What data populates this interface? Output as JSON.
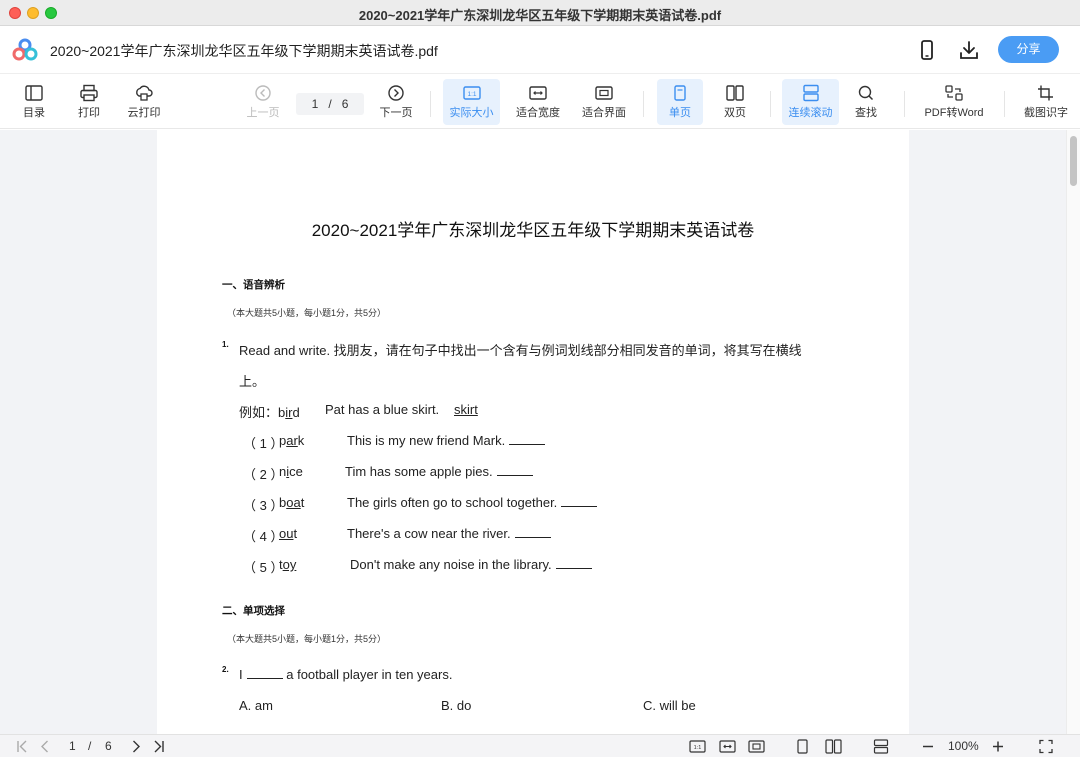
{
  "window": {
    "title": "2020~2021学年广东深圳龙华区五年级下学期期末英语试卷.pdf"
  },
  "header": {
    "doc_title": "2020~2021学年广东深圳龙华区五年级下学期期末英语试卷.pdf",
    "share_label": "分享",
    "icons": [
      "app-logo",
      "phone-icon",
      "download-icon"
    ]
  },
  "toolbar": {
    "toc": "目录",
    "print": "打印",
    "cloud_print": "云打印",
    "prev_page": "上一页",
    "page_current": "1",
    "page_sep": "/",
    "page_total": "6",
    "next_page": "下一页",
    "actual_size": "实际大小",
    "fit_width": "适合宽度",
    "fit_page": "适合界面",
    "single_page": "单页",
    "double_page": "双页",
    "continuous_scroll": "连续滚动",
    "search": "查找",
    "pdf_to_word": "PDF转Word",
    "ocr": "截图识字",
    "active_tools": [
      "实际大小",
      "单页",
      "连续滚动"
    ],
    "accent_color": "#3b8ef0"
  },
  "document": {
    "title": "2020~2021学年广东深圳龙华区五年级下学期期末英语试卷",
    "section1": {
      "title": "一、语音辨析",
      "note": "（本大题共5小题，每小题1分，共5分）"
    },
    "q1": {
      "num": "1.",
      "text_line1": "Read and write. 找朋友，请在句子中找出一个含有与例词划线部分相同发音的单词，将其写在横线",
      "text_line2": "上。",
      "example": {
        "prefix": "例如：",
        "w_a": "b",
        "w_u": "ir",
        "w_b": "d",
        "sentence": "Pat has a blue skirt.",
        "answer": "skirt"
      },
      "items": [
        {
          "label": "（ 1 ）",
          "w_a": "p",
          "w_u": "ar",
          "w_b": "k",
          "sentence": "This is my new friend Mark."
        },
        {
          "label": "（ 2 ）",
          "w_a": "n",
          "w_u": "i",
          "w_b": "ce",
          "sentence": "Tim has some apple pies."
        },
        {
          "label": "（ 3 ）",
          "w_a": "b",
          "w_u": "oa",
          "w_b": "t",
          "sentence": "The girls often go to school together."
        },
        {
          "label": "（ 4 ）",
          "w_a": "",
          "w_u": "ou",
          "w_b": "t",
          "sentence": "There's a cow near the river."
        },
        {
          "label": "（ 5 ）",
          "w_a": "t",
          "w_u": "oy",
          "w_b": "",
          "sentence": "Don't make any noise in the library."
        }
      ]
    },
    "section2": {
      "title": "二、单项选择",
      "note": "（本大题共5小题，每小题1分，共5分）"
    },
    "q2": {
      "num": "2.",
      "before": "I",
      "after": "a football player in ten years.",
      "options": [
        "A. am",
        "B. do",
        "C. will be"
      ]
    }
  },
  "statusbar": {
    "page_current": "1",
    "page_sep": "/",
    "page_total": "6",
    "zoom": "100%"
  }
}
